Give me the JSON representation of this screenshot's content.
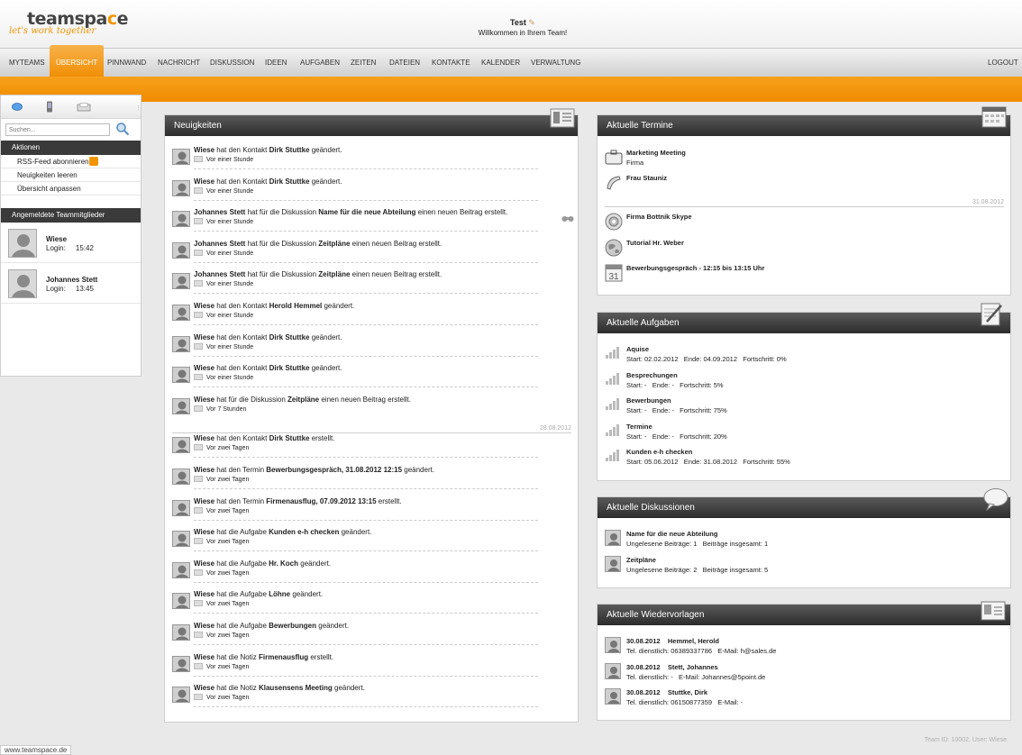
{
  "brand": {
    "name_part1": "teamspa",
    "name_c": "c",
    "name_part2": "e",
    "tagline": "let's work together"
  },
  "user": {
    "name": "Test",
    "welcome": "Willkommen in Ihrem Team!"
  },
  "nav": {
    "items": [
      "MYTEAMS",
      "ÜBERSICHT",
      "PINNWAND",
      "NACHRICHT",
      "DISKUSSION",
      "IDEEN",
      "AUFGABEN",
      "ZEITEN",
      "DATEIEN",
      "KONTAKTE",
      "KALENDER",
      "VERWALTUNG"
    ],
    "active": "ÜBERSICHT",
    "logout": "LOGOUT"
  },
  "sidebar": {
    "search_placeholder": "Suchen...",
    "actions_title": "Aktionen",
    "actions": [
      "RSS-Feed abonnieren",
      "Neuigkeiten leeren",
      "Übersicht anpassen"
    ],
    "members_title": "Angemeldete Teammitglieder",
    "members": [
      {
        "name": "Wiese",
        "login": "Login:     15:42"
      },
      {
        "name": "Johannes Stett",
        "login": "Login:     13:45"
      }
    ]
  },
  "news": {
    "title": "Neuigkeiten",
    "date_separator": "28.08.2012",
    "items": [
      {
        "user": "Wiese",
        "pre": " hat den Kontakt ",
        "obj": "Dirk Stuttke",
        "post": " geändert.",
        "time": "Vor einer Stunde"
      },
      {
        "user": "Wiese",
        "pre": " hat den Kontakt ",
        "obj": "Dirk Stuttke",
        "post": " geändert.",
        "time": "Vor einer Stunde"
      },
      {
        "user": "Johannes Stett",
        "pre": " hat für die Diskussion ",
        "obj": "Name für die neue Abteilung",
        "post": " einen neuen Beitrag erstellt.",
        "time": "Vor einer Stunde"
      },
      {
        "user": "Johannes Stett",
        "pre": " hat für die Diskussion ",
        "obj": "Zeitpläne",
        "post": " einen neuen Beitrag erstellt.",
        "time": "Vor einer Stunde"
      },
      {
        "user": "Johannes Stett",
        "pre": " hat für die Diskussion ",
        "obj": "Zeitpläne",
        "post": " einen neuen Beitrag erstellt.",
        "time": "Vor einer Stunde"
      },
      {
        "user": "Wiese",
        "pre": " hat den Kontakt ",
        "obj": "Herold Hemmel",
        "post": " geändert.",
        "time": "Vor einer Stunde"
      },
      {
        "user": "Wiese",
        "pre": " hat den Kontakt ",
        "obj": "Dirk Stuttke",
        "post": " geändert.",
        "time": "Vor einer Stunde"
      },
      {
        "user": "Wiese",
        "pre": " hat den Kontakt ",
        "obj": "Dirk Stuttke",
        "post": " geändert.",
        "time": "Vor einer Stunde"
      },
      {
        "user": "Wiese",
        "pre": " hat für die Diskussion ",
        "obj": "Zeitpläne",
        "post": " einen neuen Beitrag erstellt.",
        "time": "Vor 7 Stunden"
      },
      {
        "user": "Wiese",
        "pre": " hat den Kontakt ",
        "obj": "Dirk Stuttke",
        "post": " erstellt.",
        "time": "Vor zwei Tagen"
      },
      {
        "user": "Wiese",
        "pre": " hat den Termin ",
        "obj": "Bewerbungsgespräch, 31.08.2012 12:15",
        "post": " geändert.",
        "time": "Vor zwei Tagen"
      },
      {
        "user": "Wiese",
        "pre": " hat den Termin ",
        "obj": "Firmenausflug, 07.09.2012 13:15",
        "post": " erstellt.",
        "time": "Vor zwei Tagen"
      },
      {
        "user": "Wiese",
        "pre": " hat die Aufgabe ",
        "obj": "Kunden e-h checken",
        "post": " geändert.",
        "time": "Vor zwei Tagen"
      },
      {
        "user": "Wiese",
        "pre": " hat die Aufgabe ",
        "obj": "Hr. Koch",
        "post": " geändert.",
        "time": "Vor zwei Tagen"
      },
      {
        "user": "Wiese",
        "pre": " hat die Aufgabe ",
        "obj": "Löhne",
        "post": " geändert.",
        "time": "Vor zwei Tagen"
      },
      {
        "user": "Wiese",
        "pre": " hat die Aufgabe ",
        "obj": "Bewerbungen",
        "post": " geändert.",
        "time": "Vor zwei Tagen"
      },
      {
        "user": "Wiese",
        "pre": " hat die Notiz ",
        "obj": "Firmenausflug",
        "post": " erstellt.",
        "time": "Vor zwei Tagen"
      },
      {
        "user": "Wiese",
        "pre": " hat die Notiz ",
        "obj": "Klausensens Meeting",
        "post": " geändert.",
        "time": "Vor zwei Tagen"
      }
    ]
  },
  "termine": {
    "title": "Aktuelle Termine",
    "date_separator": "31.08.2012",
    "items": [
      {
        "title": "Marketing Meeting",
        "sub": "Firma",
        "icon": "briefcase-icon"
      },
      {
        "title": "Frau Stauniz",
        "sub": "",
        "icon": "phone-icon"
      },
      {
        "title": "Firma Bottnik Skype",
        "sub": "",
        "icon": "disc-icon"
      },
      {
        "title": "Tutorial Hr. Weber",
        "sub": "",
        "icon": "globe-icon"
      },
      {
        "title": "Bewerbungsgespräch - 12:15 bis 13:15 Uhr",
        "sub": "",
        "icon": "calendar-icon",
        "cal_day": "31"
      }
    ]
  },
  "aufgaben": {
    "title": "Aktuelle Aufgaben",
    "items": [
      {
        "title": "Aquise",
        "sub": "Start: 02.02.2012   Ende: 04.09.2012   Fortschritt: 0%",
        "progress": 0
      },
      {
        "title": "Besprechungen",
        "sub": "Start: -   Ende: -   Fortschritt: 5%",
        "progress": 5
      },
      {
        "title": "Bewerbungen",
        "sub": "Start: -   Ende: -   Fortschritt: 75%",
        "progress": 75
      },
      {
        "title": "Termine",
        "sub": "Start: -   Ende: -   Fortschritt: 20%",
        "progress": 20
      },
      {
        "title": "Kunden e-h checken",
        "sub": "Start: 05.06.2012   Ende: 31.08.2012   Fortschritt: 55%",
        "progress": 55
      }
    ]
  },
  "diskussionen": {
    "title": "Aktuelle Diskussionen",
    "items": [
      {
        "title": "Name für die neue Abteilung",
        "sub": "Ungelesene Beiträge: 1   Beiträge insgesamt: 1"
      },
      {
        "title": "Zeitpläne",
        "sub": "Ungelesene Beiträge: 2   Beiträge insgesamt: 5"
      }
    ]
  },
  "wiedervorlagen": {
    "title": "Aktuelle Wiedervorlagen",
    "items": [
      {
        "title": "30.08.2012    Hemmel, Herold",
        "sub": "Tel. dienstlich: 06389337786   E-Mail: h@sales.de"
      },
      {
        "title": "30.08.2012    Stett, Johannes",
        "sub": "Tel. dienstlich: -   E-Mail: Johannes@5point.de"
      },
      {
        "title": "30.08.2012    Stuttke, Dirk",
        "sub": "Tel. dienstlich: 06150877359   E-Mail: -"
      }
    ]
  },
  "footer": {
    "url": "www.teamspace.de",
    "team_info": "Team ID: 10002, User: Wiese"
  },
  "colors": {
    "accent": "#f29400",
    "panel_header": "#333333"
  }
}
